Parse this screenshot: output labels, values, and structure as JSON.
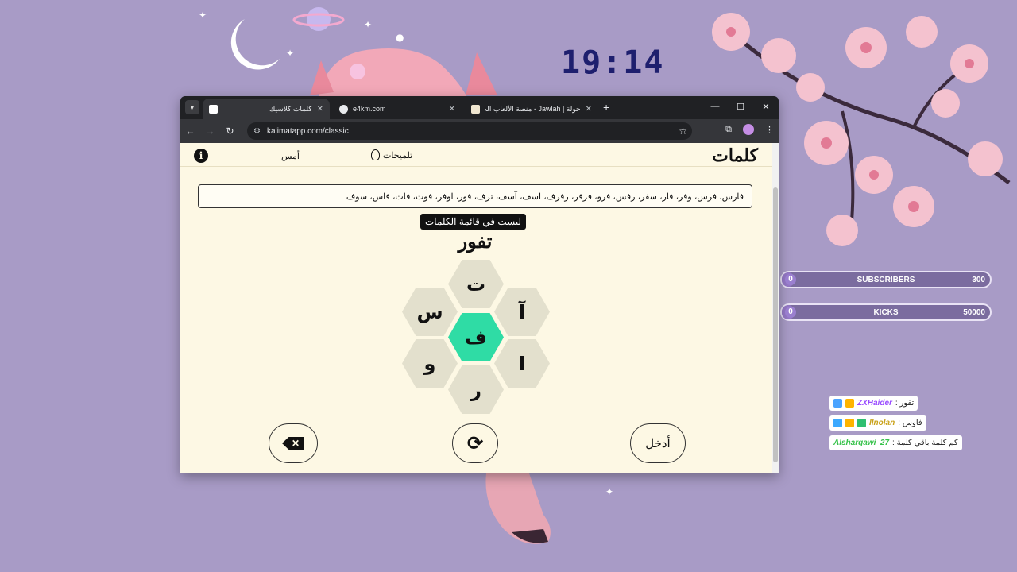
{
  "overlay": {
    "clock": "19:14",
    "goals": [
      {
        "label": "SUBSCRIBERS",
        "current": "0",
        "target": "300",
        "progress": 0.06
      },
      {
        "label": "KICKS",
        "current": "0",
        "target": "50000",
        "progress": 0.06
      }
    ],
    "chat": [
      {
        "user": "ZXHaider",
        "text": "تفور :",
        "user_color": "#9a4dff",
        "badges": [
          "#4aa3ff",
          "#ffb400"
        ]
      },
      {
        "user": "IInolan",
        "text": "فاوس :",
        "user_color": "#c9a21a",
        "badges": [
          "#3ba9ff",
          "#ffb400",
          "#2fbf71"
        ]
      },
      {
        "user": "Alsharqawi_27",
        "text": "كم كلمة باقي كلمة :",
        "user_color": "#37c24b",
        "badges": []
      }
    ]
  },
  "browser": {
    "tabs": [
      {
        "title": "كلمات كلاسيك",
        "active": true,
        "icon": "kalimat-favicon"
      },
      {
        "title": "e4km.com",
        "active": false,
        "icon": "globe-favicon"
      },
      {
        "title": "جولة | Jawlah - منصة الألعاب الت...",
        "active": false,
        "icon": "jawlah-favicon"
      }
    ],
    "url": "kalimatapp.com/classic"
  },
  "app": {
    "title": "كلمات",
    "hints_label": "تلميحات",
    "yesterday_label": "أمس",
    "info_symbol": "i",
    "found_words": "فارس، فرس، وفر، فار، سفر، رفس، فرو، فرفر، رفرف، اسف، آسف، ترف، فور، اوفر، فوت، فات، فاس، سوف",
    "toast": "ليست في قائمة الكلمات",
    "current_input": "تفور",
    "letters": {
      "center": "ف",
      "top": "ت",
      "top_right": "آ",
      "bottom_right": "ا",
      "bottom": "ر",
      "bottom_left": "و",
      "top_left": "س"
    },
    "buttons": {
      "delete_symbol": "✕",
      "shuffle_symbol": "⟳",
      "enter_label": "أدخل"
    }
  },
  "colors": {
    "accent": "#2fdca5",
    "hex_bg": "#e3e0cd",
    "page_bg": "#fdf8e4"
  }
}
